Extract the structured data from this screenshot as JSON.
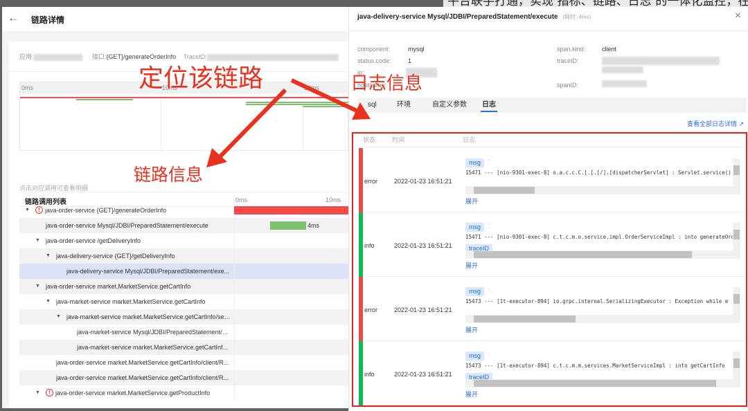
{
  "background_article": "平台联手打通，实现“指标、链路、日志”的一体化监控，在查看链路详情时关联查看所对应信",
  "left_panel": {
    "title": "链路详情",
    "info": {
      "app_label": "应用:",
      "api_label": "接口:",
      "api_value": "{GET}/generateOrderInfo",
      "traceid_label": "TraceID:"
    },
    "timeline_ticks": [
      "0ms",
      "10ms",
      "20ms"
    ],
    "hint": "点击对应调用可查看明细",
    "table": {
      "header": "链路调用列表",
      "ticks": [
        "0ms",
        "10ms"
      ],
      "rows": [
        {
          "label": "java-order-service {GET}/generateOrderInfo",
          "error": true,
          "caret": true,
          "level": 0
        },
        {
          "label": "java-order-service Mysql/JDBI/PreparedStatement/execute",
          "level": 1,
          "duration": "4ms"
        },
        {
          "label": "java-order-service /getDeliveryInfo",
          "caret": true,
          "level": 1
        },
        {
          "label": "java-delivery-service {GET}/getDeliveryInfo",
          "caret": true,
          "level": 2
        },
        {
          "label": "java-delivery-service Mysql/JDBI/PreparedStatement/exe...",
          "level": 3,
          "selected": true
        },
        {
          "label": "java-order-service market.MarketService.getCartInfo",
          "caret": true,
          "level": 1
        },
        {
          "label": "java-market-service market.MarketService.getCartInfo",
          "caret": true,
          "level": 2
        },
        {
          "label": "java-market-service market.MarketService.getCartInfo/ser...",
          "caret": true,
          "level": 3
        },
        {
          "label": "java-market-service Mysql/JDBI/PreparedStatement/e...",
          "level": 4
        },
        {
          "label": "java-market-service market.MarketService.getCartInfo...",
          "level": 4
        },
        {
          "label": "java-order-service market.MarketService.getCartInfo/client/R...",
          "level": 2
        },
        {
          "label": "java-order-service market.MarketService.getCartInfo/client/R...",
          "level": 2
        },
        {
          "label": "java-order-service market.MarketService.getProductInfo",
          "error": true,
          "caret": true,
          "level": 1
        }
      ]
    }
  },
  "right_panel": {
    "title": "java-delivery-service Mysql/JDBI/PreparedStatement/execute",
    "duration": "(耗时: 4ms)",
    "fields": {
      "component_label": "component:",
      "component_value": "mysql",
      "status_label": "status.code:",
      "status_value": "1",
      "ip_label": "ip:",
      "hostname_label": "hostname:",
      "spankind_label": "span.kind:",
      "spankind_value": "client",
      "traceid_label": "traceID:",
      "spanid_label": "spanID:"
    },
    "tabs": [
      "sql",
      "环境",
      "自定义参数",
      "日志"
    ],
    "active_tab": "日志",
    "view_all_logs": "查看全部日志详情",
    "log_table": {
      "headers": [
        "状态",
        "时间",
        "日志"
      ],
      "rows": [
        {
          "status": "error",
          "time": "2022-01-23 16:51:21",
          "tag": "msg",
          "text": "15471 --- [nio-9301-exec-8] o.a.c.c.C.[.[.[/].[dispatcherServlet]    : Servlet.service()",
          "tag2": "",
          "expand": "展开",
          "hscroll": 0.25
        },
        {
          "status": "info",
          "time": "2022-01-23 16:51:21",
          "tag": "msg",
          "text": "15471 --- [nio-9301-exec-8] c.t.c.m.o.service.impl.OrderServiceImpl  : into generateOrde",
          "tag2": "traceID",
          "expand": "展开",
          "hscroll": 0.9
        },
        {
          "status": "error",
          "time": "2022-01-23 16:51:21",
          "tag": "msg",
          "text": "15473 --- [1t-executor-894] io.grpc.internal.SerializingExecutor     : Exception while e",
          "tag2": "",
          "expand": "展开",
          "hscroll": 0.42
        },
        {
          "status": "info",
          "time": "2022-01-23 16:51:21",
          "tag": "msg",
          "text": "15473 --- [1t-executor-894] c.t.c.m.m.services.MarketServiceImpl     : into getCartInfo",
          "tag2": "traceID",
          "expand": "展开",
          "hscroll": 1.0
        }
      ]
    }
  },
  "annotations": {
    "locate": "定位该链路",
    "trace_info": "链路信息",
    "log_info": "日志信息"
  },
  "colors": {
    "error": "#e84b4b",
    "info": "#13b955",
    "accent": "#2a6fd6",
    "annotation": "#e8311f",
    "span_bar": "#7cc070"
  }
}
